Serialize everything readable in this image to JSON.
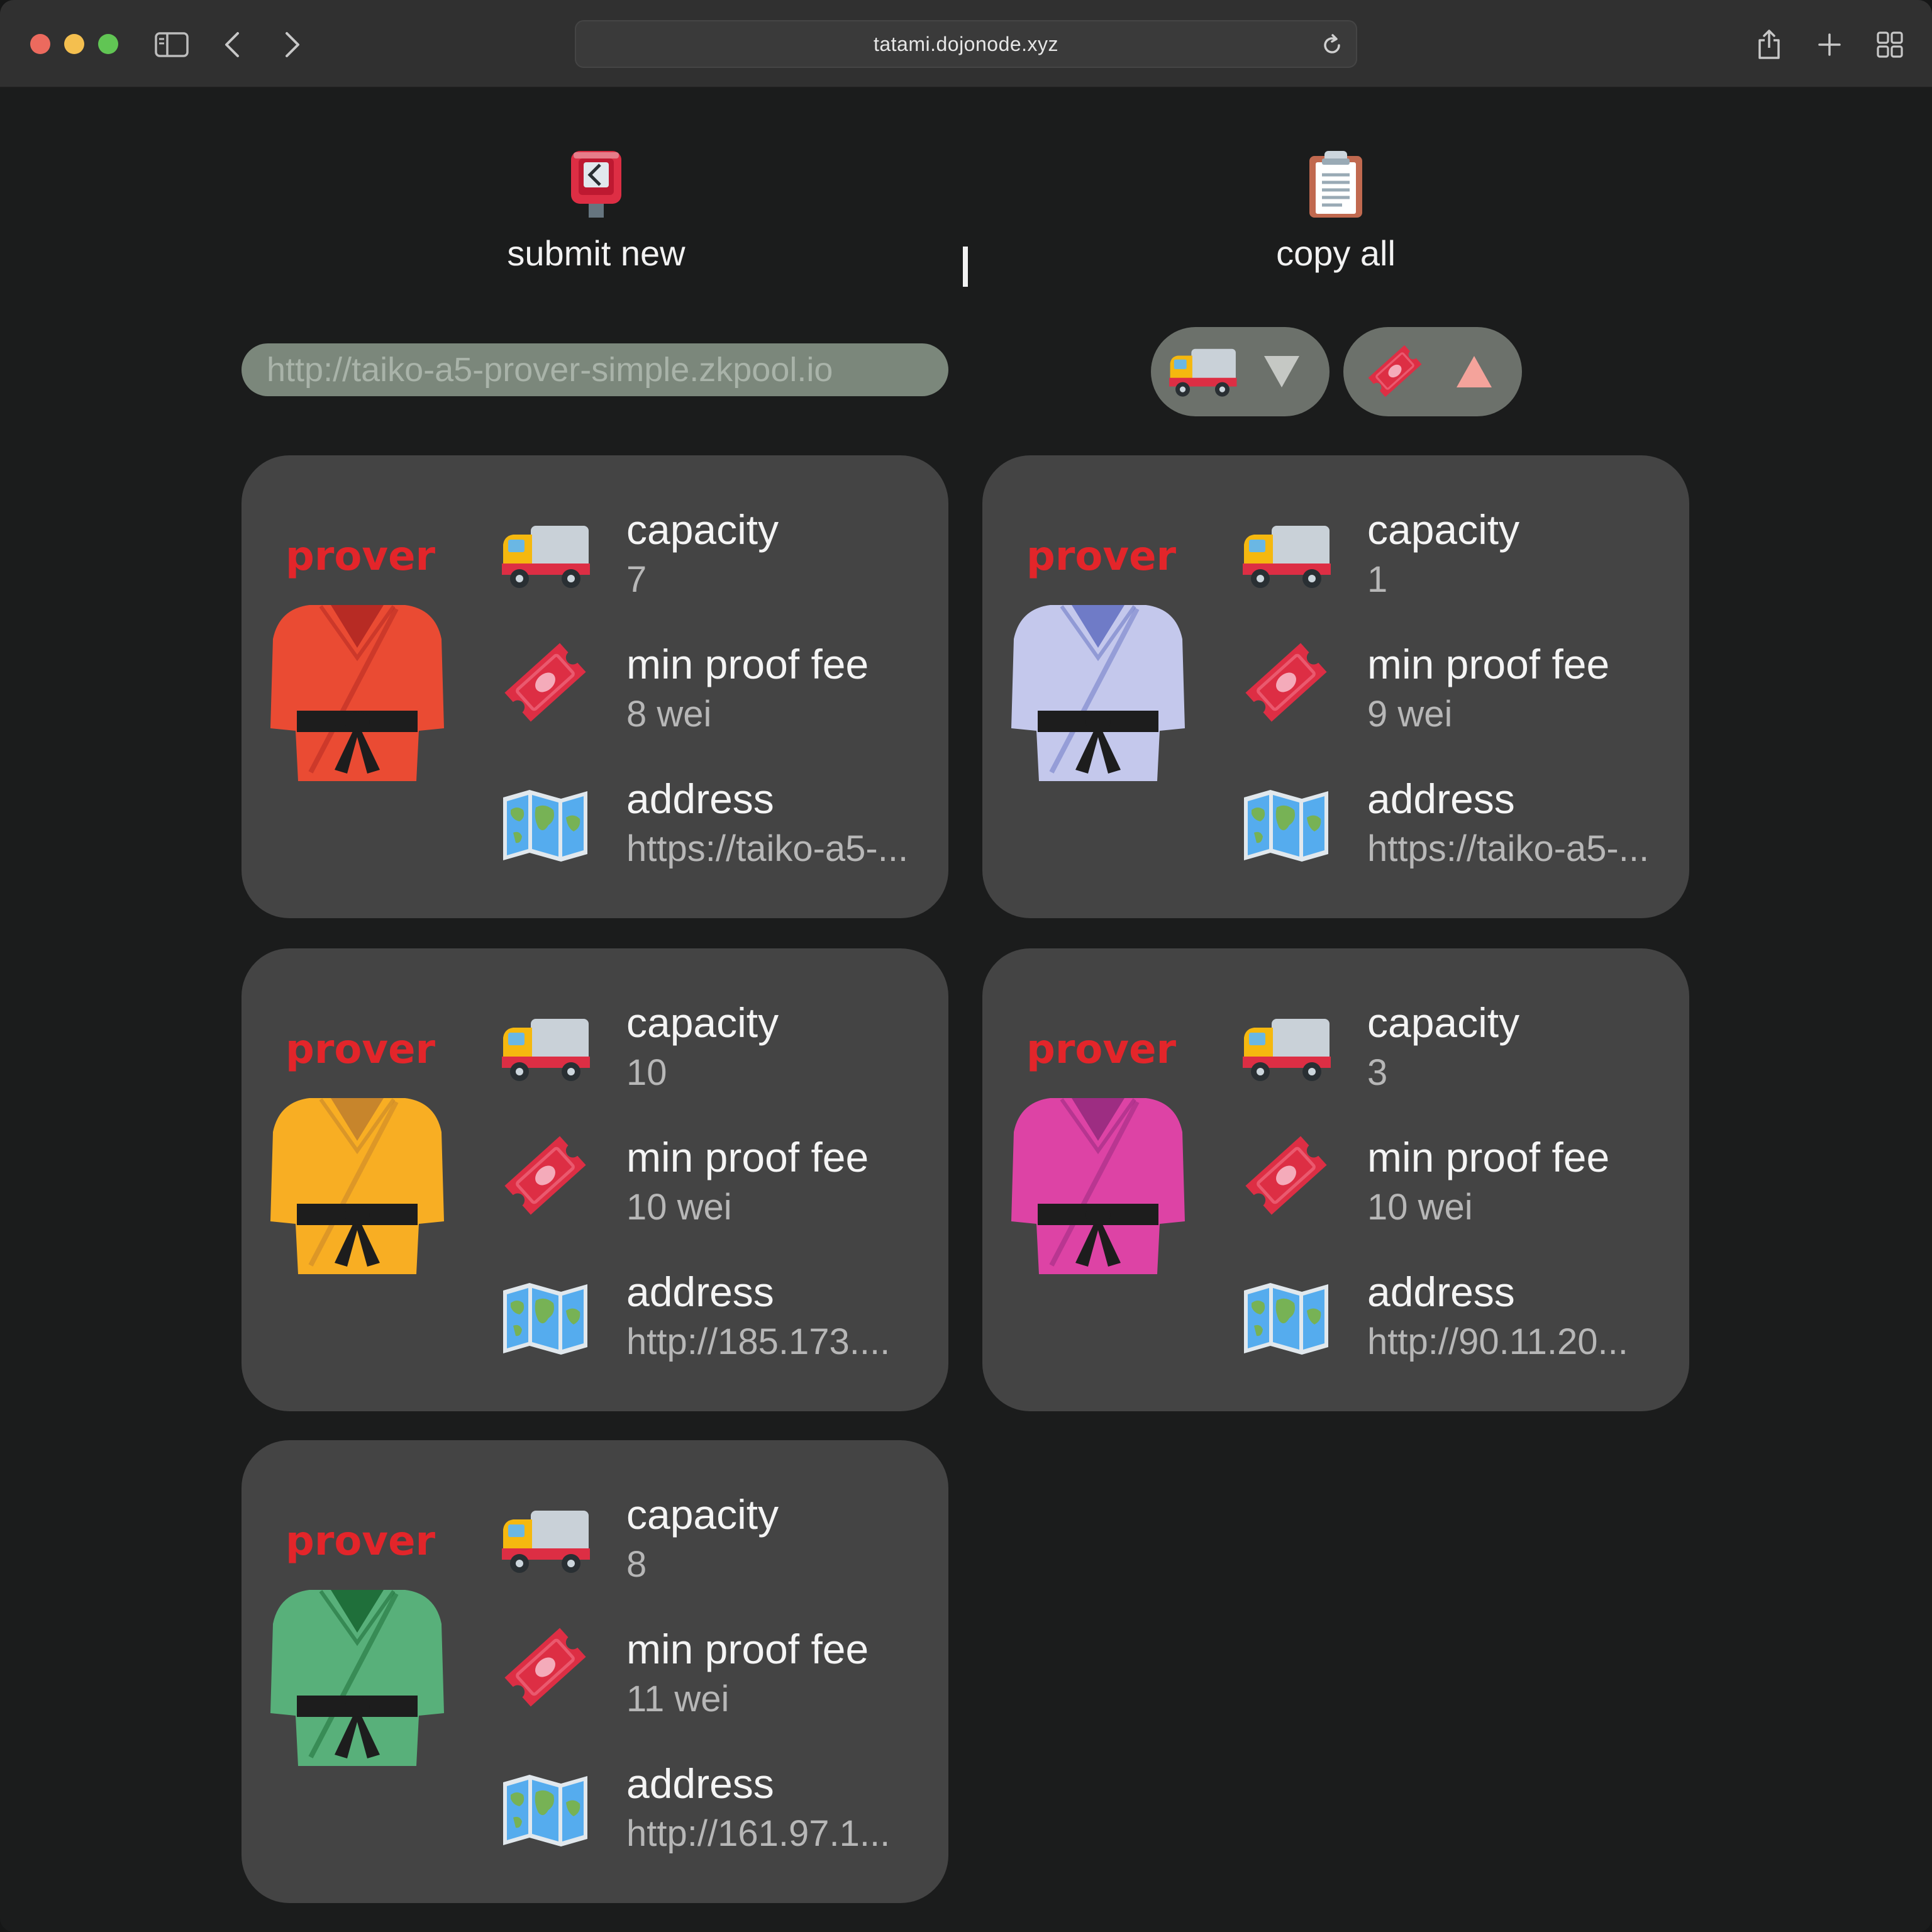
{
  "browser": {
    "url": "tatami.dojonode.xyz"
  },
  "actions": {
    "submit_label": "submit new",
    "copy_label": "copy all"
  },
  "filter": {
    "placeholder": "http://taiko-a5-prover-simple.zkpool.io"
  },
  "sort": {
    "capacity_icon": "truck-icon",
    "capacity_direction": "descending",
    "fee_icon": "ticket-icon",
    "fee_direction": "ascending"
  },
  "labels": {
    "prover": "prover",
    "capacity": "capacity",
    "fee": "min proof fee",
    "address": "address"
  },
  "provers": [
    {
      "gi_color": "#ea4b33",
      "gi_dark": "#b72b24",
      "capacity": "7",
      "fee": "8 wei",
      "address": "https://taiko-a5-..."
    },
    {
      "gi_color": "#c4c8ec",
      "gi_dark": "#6f7bc7",
      "capacity": "1",
      "fee": "9 wei",
      "address": "https://taiko-a5-..."
    },
    {
      "gi_color": "#f8ae23",
      "gi_dark": "#c7852c",
      "capacity": "10",
      "fee": "10 wei",
      "address": "http://185.173...."
    },
    {
      "gi_color": "#dd43a5",
      "gi_dark": "#9d2d82",
      "capacity": "3",
      "fee": "10 wei",
      "address": "http://90.11.20..."
    },
    {
      "gi_color": "#58b07a",
      "gi_dark": "#1f6f3a",
      "capacity": "8",
      "fee": "11 wei",
      "address": "http://161.97.1..."
    }
  ],
  "colors": {
    "background": "#1b1c1c",
    "card": "#444444",
    "accent_red": "#e3252a",
    "filter_bg": "#7b877b"
  }
}
